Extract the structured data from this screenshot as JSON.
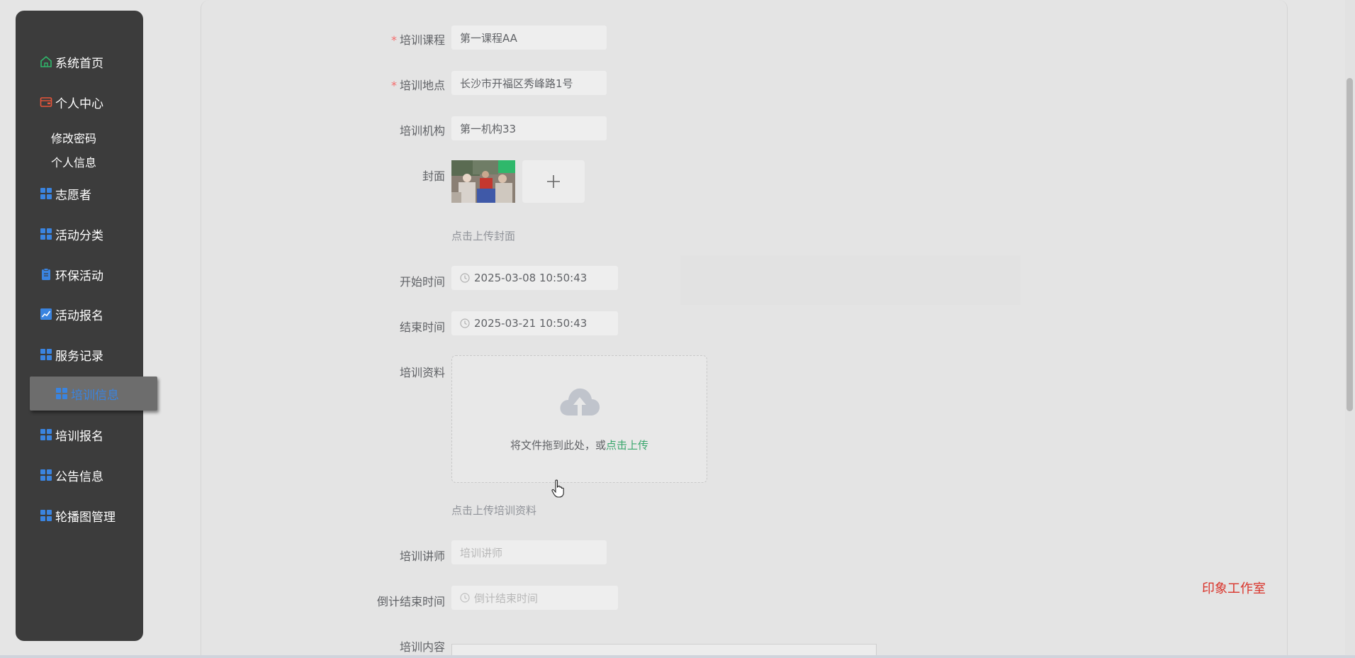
{
  "sidebar": {
    "items": [
      {
        "label": "系统首页",
        "icon": "home-icon"
      },
      {
        "label": "个人中心",
        "icon": "wallet-icon"
      },
      {
        "label": "志愿者",
        "icon": "grid-icon"
      },
      {
        "label": "活动分类",
        "icon": "grid-icon"
      },
      {
        "label": "环保活动",
        "icon": "clipboard-icon"
      },
      {
        "label": "活动报名",
        "icon": "chart-icon"
      },
      {
        "label": "服务记录",
        "icon": "grid-icon"
      },
      {
        "label": "培训信息",
        "icon": "grid-icon"
      },
      {
        "label": "培训报名",
        "icon": "grid-icon"
      },
      {
        "label": "公告信息",
        "icon": "grid-icon"
      },
      {
        "label": "轮播图管理",
        "icon": "grid-icon"
      }
    ],
    "sub_items": [
      "修改密码",
      "个人信息"
    ],
    "active_label": "培训信息"
  },
  "form": {
    "course": {
      "label": "培训课程",
      "value": "第一课程AA"
    },
    "location": {
      "label": "培训地点",
      "value": "长沙市开福区秀峰路1号"
    },
    "org": {
      "label": "培训机构",
      "value": "第一机构33"
    },
    "cover": {
      "label": "封面",
      "hint": "点击上传封面"
    },
    "start": {
      "label": "开始时间",
      "value": "2025-03-08 10:50:43"
    },
    "end": {
      "label": "结束时间",
      "value": "2025-03-21 10:50:43"
    },
    "material": {
      "label": "培训资料",
      "drop_text": "将文件拖到此处，或",
      "drop_link": "点击上传",
      "hint": "点击上传培训资料"
    },
    "teacher": {
      "label": "培训讲师",
      "placeholder": "培训讲师"
    },
    "countdown": {
      "label": "倒计结束时间",
      "placeholder": "倒计结束时间"
    },
    "content": {
      "label": "培训内容"
    }
  },
  "watermark": "印象工作室",
  "colors": {
    "sidebar_bg": "#3c3c3c",
    "active_text": "#3a84e0",
    "required": "#f56c6c",
    "link": "#3aa76d",
    "watermark": "#d9342b"
  }
}
